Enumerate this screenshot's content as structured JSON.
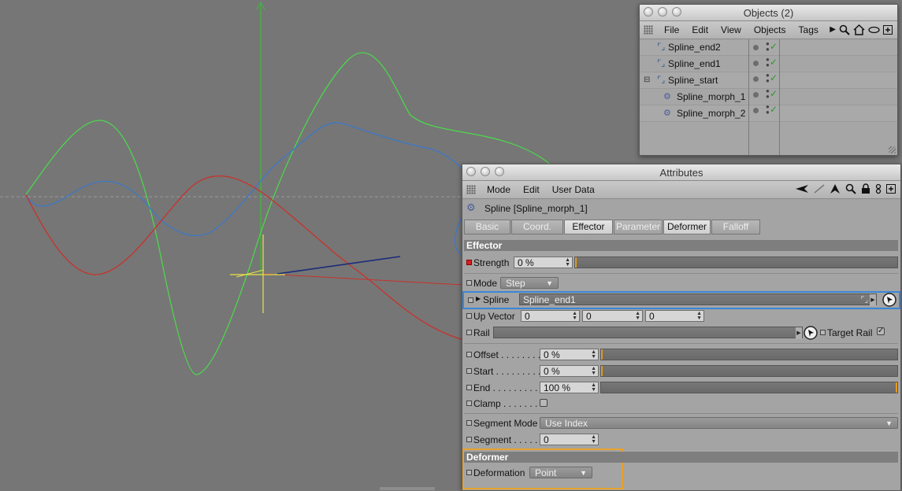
{
  "viewport": {
    "curves": {
      "green": "#4dd64d",
      "blue": "#3d78c8",
      "red": "#c8322c",
      "axis_green": "#3cbc3c",
      "navy": "#1a2a7a",
      "yellow": "#e9e24a"
    }
  },
  "objects_window": {
    "title": "Objects (2)",
    "menu": [
      "File",
      "Edit",
      "View",
      "Objects",
      "Tags"
    ],
    "tool_icons": [
      "arrow-right-icon",
      "search-icon",
      "home-icon",
      "eye-icon",
      "new-window-icon"
    ],
    "items": [
      {
        "name": "Spline_end2",
        "icon": "spline-icon",
        "indent": 0
      },
      {
        "name": "Spline_end1",
        "icon": "spline-icon",
        "indent": 0
      },
      {
        "name": "Spline_start",
        "icon": "spline-icon",
        "indent": 0
      },
      {
        "name": "Spline_morph_1",
        "icon": "effector-icon",
        "indent": 1
      },
      {
        "name": "Spline_morph_2",
        "icon": "effector-icon",
        "indent": 1
      }
    ]
  },
  "attributes_window": {
    "title": "Attributes",
    "menu": [
      "Mode",
      "Edit",
      "User Data"
    ],
    "object_title": "Spline [Spline_morph_1]",
    "tabs": [
      "Basic",
      "Coord.",
      "Effector",
      "Parameter",
      "Deformer",
      "Falloff"
    ],
    "active_tabs": [
      "Effector",
      "Deformer"
    ],
    "effector": {
      "section": "Effector",
      "strength_label": "Strength",
      "strength_value": "0 %",
      "strength_fraction": 0.0,
      "mode_label": "Mode",
      "mode_value": "Step",
      "spline_label": "Spline",
      "spline_value": "Spline_end1",
      "up_vector_label": "Up Vector",
      "up_vector": [
        "0",
        "0",
        "0"
      ],
      "rail_label": "Rail",
      "rail_value": "",
      "target_rail_label": "Target Rail",
      "offset_label": "Offset . . . . . . . .",
      "offset_value": "0 %",
      "offset_fraction": 0.0,
      "start_label": "Start . . . . . . . . .",
      "start_value": "0 %",
      "start_fraction": 0.0,
      "end_label": "End . . . . . . . . . .",
      "end_value": "100 %",
      "end_fraction": 1.0,
      "clamp_label": "Clamp . . . . . . . .",
      "segment_mode_label": "Segment Mode",
      "segment_mode_value": "Use Index",
      "segment_label": "Segment . . . . . .",
      "segment_value": "0"
    },
    "deformer": {
      "section": "Deformer",
      "deformation_label": "Deformation",
      "deformation_value": "Point"
    }
  },
  "highlight_colors": {
    "spline_row": "#3a86d8",
    "deformer_box": "#e9a12a"
  }
}
